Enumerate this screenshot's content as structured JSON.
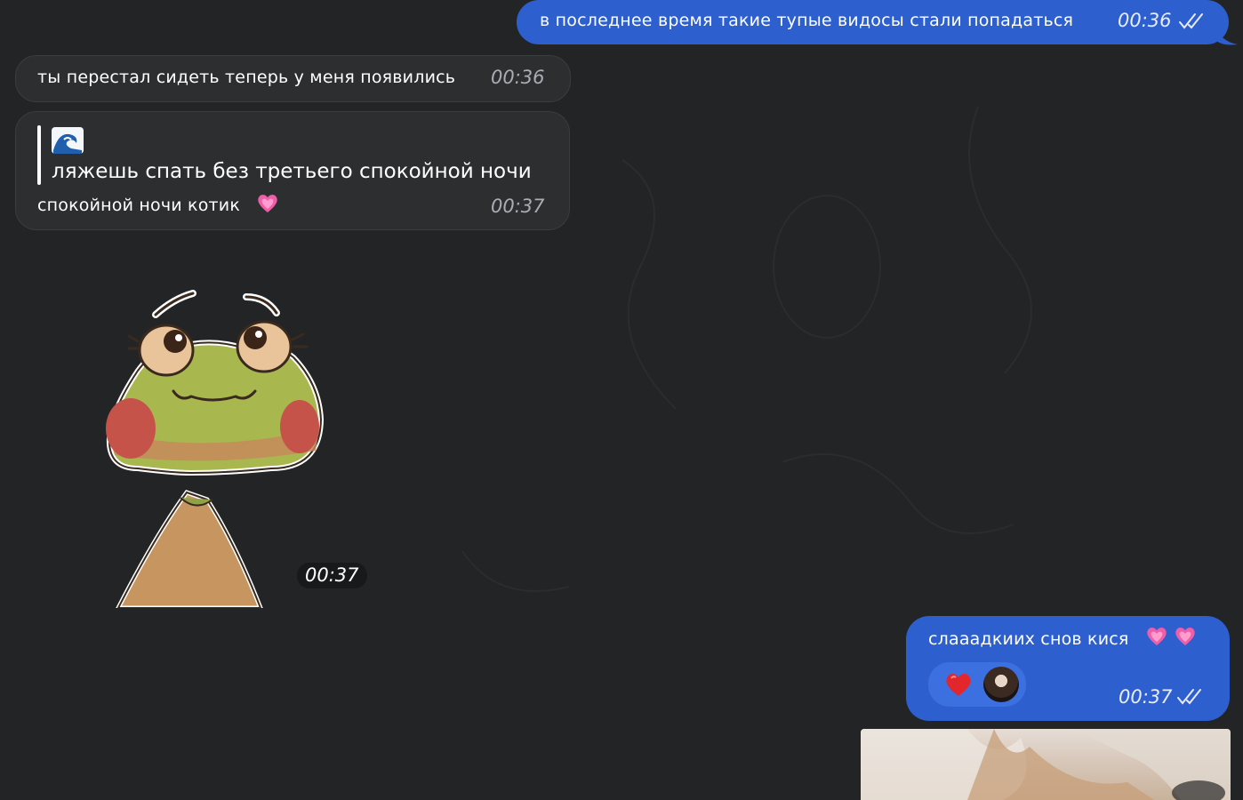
{
  "messages": [
    {
      "id": "m1",
      "direction": "outgoing",
      "text": "в последнее время такие тупые видосы стали попадаться",
      "time": "00:36",
      "status": "read-double-check"
    },
    {
      "id": "m2",
      "direction": "incoming",
      "text": "ты перестал сидеть теперь у меня появились",
      "time": "00:36"
    },
    {
      "id": "m3",
      "direction": "incoming",
      "quote": {
        "icon": "wave-emoji",
        "text": "ляжешь спать без третьего спокойной ночи"
      },
      "text": "спокойной ночи котик",
      "emoji": "pink-heart-emoji",
      "time": "00:37"
    },
    {
      "id": "m4",
      "direction": "incoming",
      "type": "sticker",
      "sticker": "frog-sticker",
      "time": "00:37"
    },
    {
      "id": "m5",
      "direction": "outgoing",
      "text": "слааадкиих снов кися",
      "emojis": [
        "pink-heart-emoji",
        "pink-heart-emoji"
      ],
      "reaction": {
        "emoji": "red-heart-emoji",
        "reactor": "avatar"
      },
      "time": "00:37",
      "status": "read-double-check"
    },
    {
      "id": "m6",
      "direction": "outgoing",
      "type": "media",
      "media": "photo-preview"
    }
  ],
  "colors": {
    "background": "#222426",
    "outgoing_bubble": "#2d5fcf",
    "incoming_bubble": "#2c2e30",
    "reaction_pill": "#3c6fe0"
  }
}
